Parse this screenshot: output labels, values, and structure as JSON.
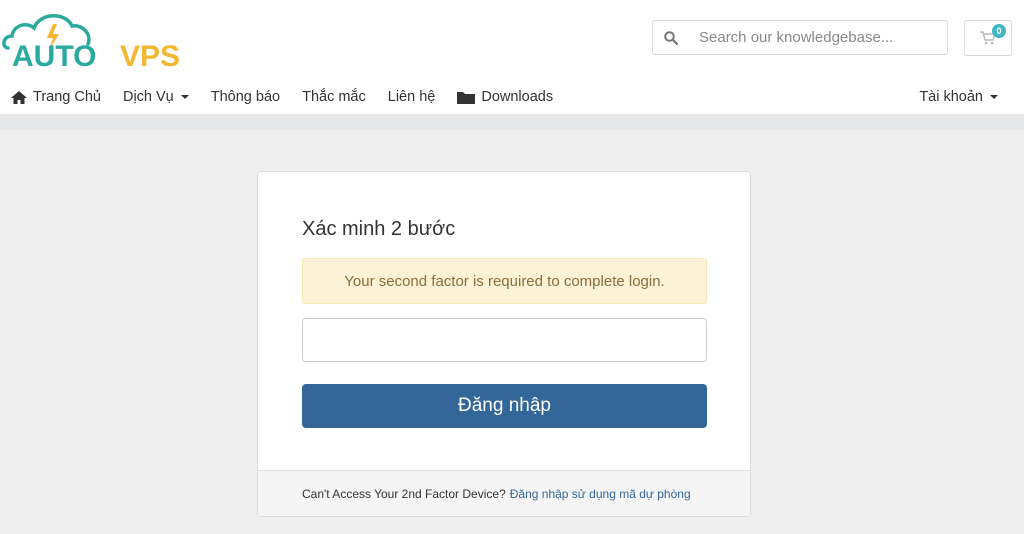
{
  "brand": {
    "logo_text_a": "AUTO",
    "logo_text_b": "VPS",
    "color_primary": "#2aa9a0",
    "color_accent": "#f5b731"
  },
  "header": {
    "search": {
      "placeholder": "Search our knowledgebase...",
      "icon": "search-icon"
    },
    "cart": {
      "count": "0",
      "icon": "cart-icon"
    }
  },
  "nav": {
    "items": [
      {
        "label": "Trang Chủ",
        "icon": "home-icon"
      },
      {
        "label": "Dịch Vụ",
        "dropdown": true
      },
      {
        "label": "Thông báo"
      },
      {
        "label": "Thắc mắc"
      },
      {
        "label": "Liên hệ"
      },
      {
        "label": "Downloads",
        "icon": "folder-icon"
      }
    ],
    "account_label": "Tài khoản"
  },
  "card": {
    "title": "Xác minh 2 bước",
    "alert": "Your second factor is required to complete login.",
    "code_value": "",
    "login_label": "Đăng nhập",
    "footer_text": "Can't Access Your 2nd Factor Device?",
    "footer_link": "Đăng nhập sử dụng mã dự phòng"
  },
  "colors": {
    "button": "#336699",
    "alert_bg": "#fcf3d6",
    "alert_text": "#8a6d3b",
    "badge": "#3fb6c3"
  }
}
